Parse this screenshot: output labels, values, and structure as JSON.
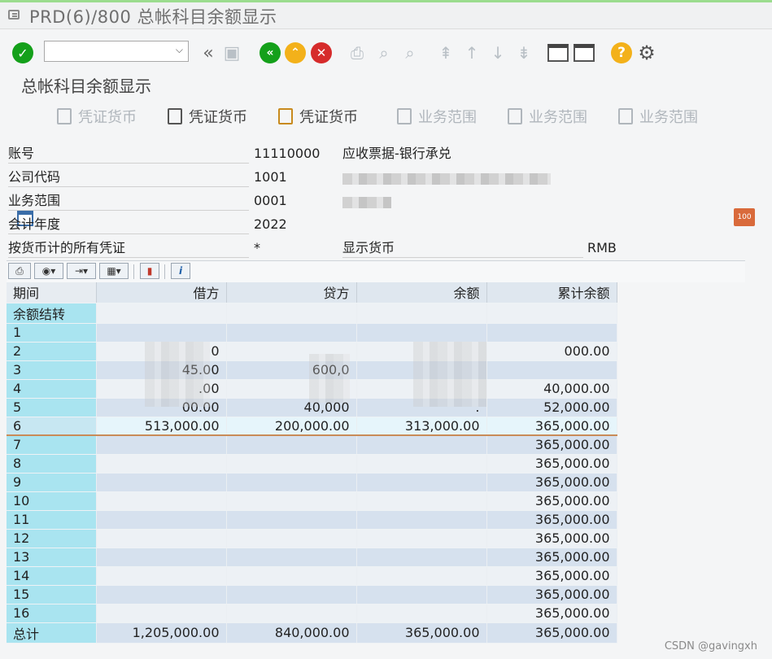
{
  "window": {
    "title": "PRD(6)/800 总帐科目余额显示"
  },
  "screen": {
    "title": "总帐科目余额显示"
  },
  "appbar": {
    "btn1": "凭证货币",
    "btn2": "凭证货币",
    "btn3": "凭证货币",
    "btn4": "业务范围",
    "btn5": "业务范围",
    "btn6": "业务范围"
  },
  "header": {
    "account_label": "账号",
    "account_value": "11110000",
    "account_desc": "应收票据-银行承兑",
    "company_label": "公司代码",
    "company_value": "1001",
    "business_area_label": "业务范围",
    "business_area_value": "0001",
    "fiscal_year_label": "会计年度",
    "fiscal_year_value": "2022",
    "all_docs_label": "按货币计的所有凭证",
    "all_docs_value": "*",
    "display_currency_label": "显示货币",
    "display_currency_value": "RMB"
  },
  "table": {
    "columns": [
      "期间",
      "借方",
      "贷方",
      "余额",
      "累计余额"
    ],
    "rows": [
      {
        "period": "余额结转",
        "debit": "",
        "credit": "",
        "balance": "",
        "cumulative": ""
      },
      {
        "period": "1",
        "debit": "",
        "credit": "",
        "balance": "",
        "cumulative": ""
      },
      {
        "period": "2",
        "debit": "0",
        "credit": "",
        "balance": "",
        "cumulative": "000.00"
      },
      {
        "period": "3",
        "debit": "45.00",
        "credit": "600,0",
        "balance": "",
        "cumulative": ""
      },
      {
        "period": "4",
        "debit": ".00",
        "credit": "",
        "balance": "",
        "cumulative": "40,000.00"
      },
      {
        "period": "5",
        "debit": "00.00",
        "credit": "40,000",
        "balance": ".",
        "cumulative": "52,000.00"
      },
      {
        "period": "6",
        "debit": "513,000.00",
        "credit": "200,000.00",
        "balance": "313,000.00",
        "cumulative": "365,000.00"
      },
      {
        "period": "7",
        "debit": "",
        "credit": "",
        "balance": "",
        "cumulative": "365,000.00"
      },
      {
        "period": "8",
        "debit": "",
        "credit": "",
        "balance": "",
        "cumulative": "365,000.00"
      },
      {
        "period": "9",
        "debit": "",
        "credit": "",
        "balance": "",
        "cumulative": "365,000.00"
      },
      {
        "period": "10",
        "debit": "",
        "credit": "",
        "balance": "",
        "cumulative": "365,000.00"
      },
      {
        "period": "11",
        "debit": "",
        "credit": "",
        "balance": "",
        "cumulative": "365,000.00"
      },
      {
        "period": "12",
        "debit": "",
        "credit": "",
        "balance": "",
        "cumulative": "365,000.00"
      },
      {
        "period": "13",
        "debit": "",
        "credit": "",
        "balance": "",
        "cumulative": "365,000.00"
      },
      {
        "period": "14",
        "debit": "",
        "credit": "",
        "balance": "",
        "cumulative": "365,000.00"
      },
      {
        "period": "15",
        "debit": "",
        "credit": "",
        "balance": "",
        "cumulative": "365,000.00"
      },
      {
        "period": "16",
        "debit": "",
        "credit": "",
        "balance": "",
        "cumulative": "365,000.00"
      },
      {
        "period": "总计",
        "debit": "1,205,000.00",
        "credit": "840,000.00",
        "balance": "365,000.00",
        "cumulative": "365,000.00"
      }
    ],
    "selected_period": "6"
  },
  "footer": {
    "watermark": "CSDN @gavingxh"
  },
  "colors": {
    "accent_green": "#14a01a",
    "period_col": "#a9e4f0",
    "stripe": "#d6e1ee"
  }
}
